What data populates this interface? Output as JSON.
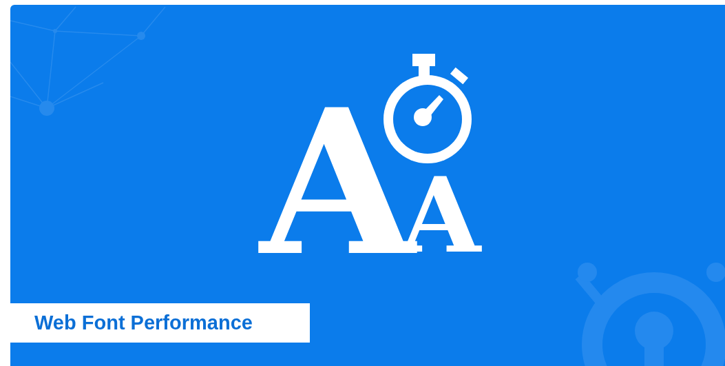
{
  "banner": {
    "logo_letters": [
      "A",
      "A"
    ],
    "title": "Web Font Performance"
  }
}
